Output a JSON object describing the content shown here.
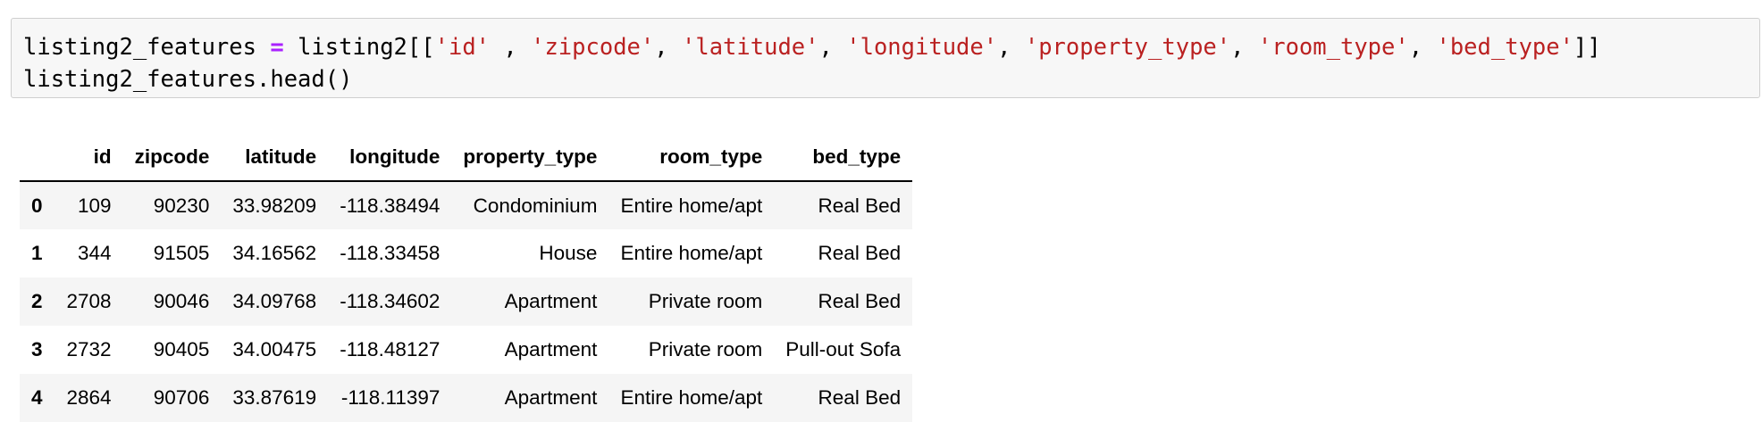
{
  "cell": {
    "line1": {
      "var": "listing2_features",
      "op": "=",
      "call_open": "listing2[[",
      "args": [
        "'id'",
        "'zipcode'",
        "'latitude'",
        "'longitude'",
        "'property_type'",
        "'room_type'",
        "'bed_type'"
      ],
      "call_close": "]]"
    },
    "line2": "listing2_features.head()"
  },
  "table": {
    "index_header": "",
    "columns": [
      "id",
      "zipcode",
      "latitude",
      "longitude",
      "property_type",
      "room_type",
      "bed_type"
    ],
    "rows": [
      {
        "index": "0",
        "cells": [
          "109",
          "90230",
          "33.98209",
          "-118.38494",
          "Condominium",
          "Entire home/apt",
          "Real Bed"
        ]
      },
      {
        "index": "1",
        "cells": [
          "344",
          "91505",
          "34.16562",
          "-118.33458",
          "House",
          "Entire home/apt",
          "Real Bed"
        ]
      },
      {
        "index": "2",
        "cells": [
          "2708",
          "90046",
          "34.09768",
          "-118.34602",
          "Apartment",
          "Private room",
          "Real Bed"
        ]
      },
      {
        "index": "3",
        "cells": [
          "2732",
          "90405",
          "34.00475",
          "-118.48127",
          "Apartment",
          "Private room",
          "Pull-out Sofa"
        ]
      },
      {
        "index": "4",
        "cells": [
          "2864",
          "90706",
          "33.87619",
          "-118.11397",
          "Apartment",
          "Entire home/apt",
          "Real Bed"
        ]
      }
    ]
  }
}
